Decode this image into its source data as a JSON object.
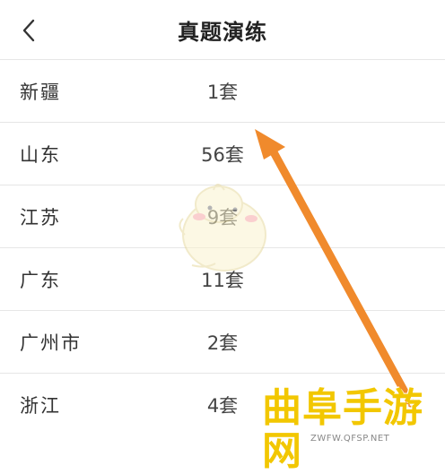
{
  "header": {
    "back_icon": "chevron-left-icon",
    "title": "真题演练"
  },
  "regions": [
    {
      "name": "新疆",
      "count": "1套"
    },
    {
      "name": "山东",
      "count": "56套"
    },
    {
      "name": "江苏",
      "count": "9套"
    },
    {
      "name": "广东",
      "count": "11套"
    },
    {
      "name": "广州市",
      "count": "2套"
    },
    {
      "name": "浙江",
      "count": "4套"
    }
  ],
  "watermark": {
    "text": "曲阜手游网",
    "url": "ZWFW.QFSP.NET",
    "color": "#f2c700"
  },
  "annotation": {
    "arrow_icon": "arrow-annotation",
    "color": "#f08a2c"
  }
}
